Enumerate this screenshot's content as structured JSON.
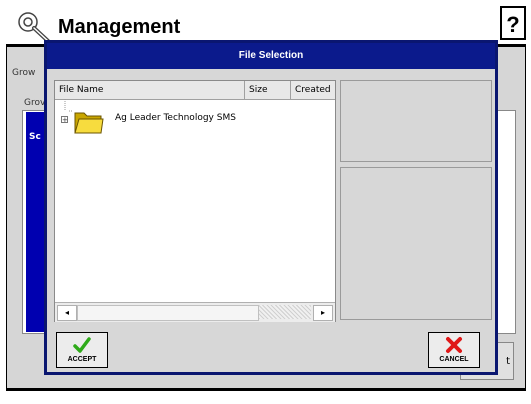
{
  "window": {
    "title": "Management",
    "help_label": "?",
    "label_top": "Grow",
    "label_group": "Grov",
    "selected_item": "Sc",
    "right_button_label": "t"
  },
  "dialog": {
    "title": "File Selection",
    "columns": {
      "name": "File Name",
      "size": "Size",
      "created": "Created"
    },
    "tree": [
      {
        "label": "Ag Leader Technology SMS",
        "icon": "folder-icon",
        "expander": "+"
      }
    ],
    "scroll": {
      "left": "◂",
      "right": "▸"
    },
    "accept_label": "ACCEPT",
    "cancel_label": "CANCEL"
  },
  "colors": {
    "dialog_title_bg": "#0b1a8c",
    "selected_bg": "#0000b0",
    "accept_icon": "#2eaa19",
    "cancel_icon": "#e01818"
  }
}
